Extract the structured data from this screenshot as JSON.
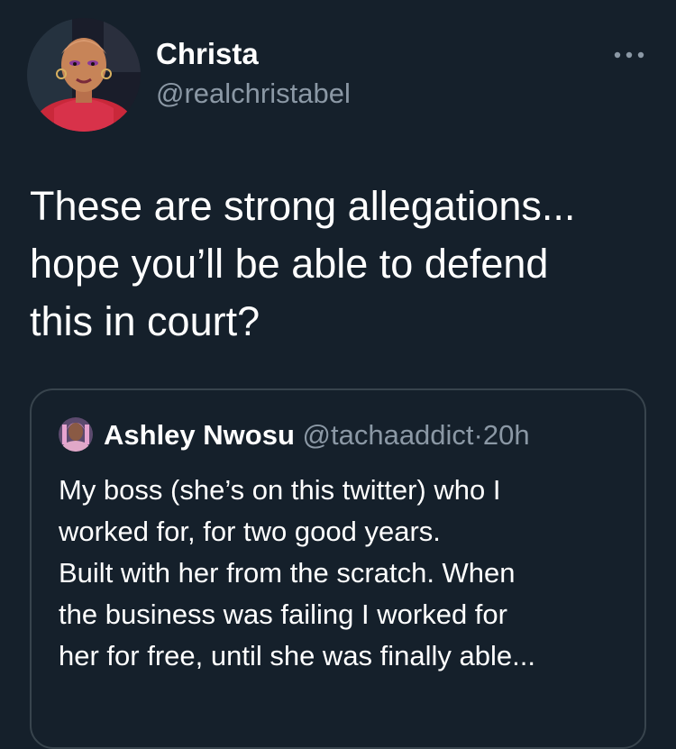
{
  "author": {
    "name": "Christa",
    "handle": "@realchristabel",
    "avatar_icon": "profile-photo"
  },
  "more_icon": "more-options-icon",
  "tweet": {
    "lines": [
      "These are strong allegations...",
      "hope you’ll be able to defend",
      "this in court?"
    ]
  },
  "quoted_tweet": {
    "name": "Ashley Nwosu",
    "handle": "@tachaaddict",
    "separator": "·",
    "time": "20h",
    "lines": [
      "My boss (she’s on this twitter) who I",
      "worked for, for two good years.",
      "Built with her from the scratch. When",
      "the business was failing I worked for",
      "her for free, until she was finally able..."
    ]
  },
  "colors": {
    "background": "#15202b",
    "secondary_text": "#8b98a5",
    "border": "#38444d"
  }
}
